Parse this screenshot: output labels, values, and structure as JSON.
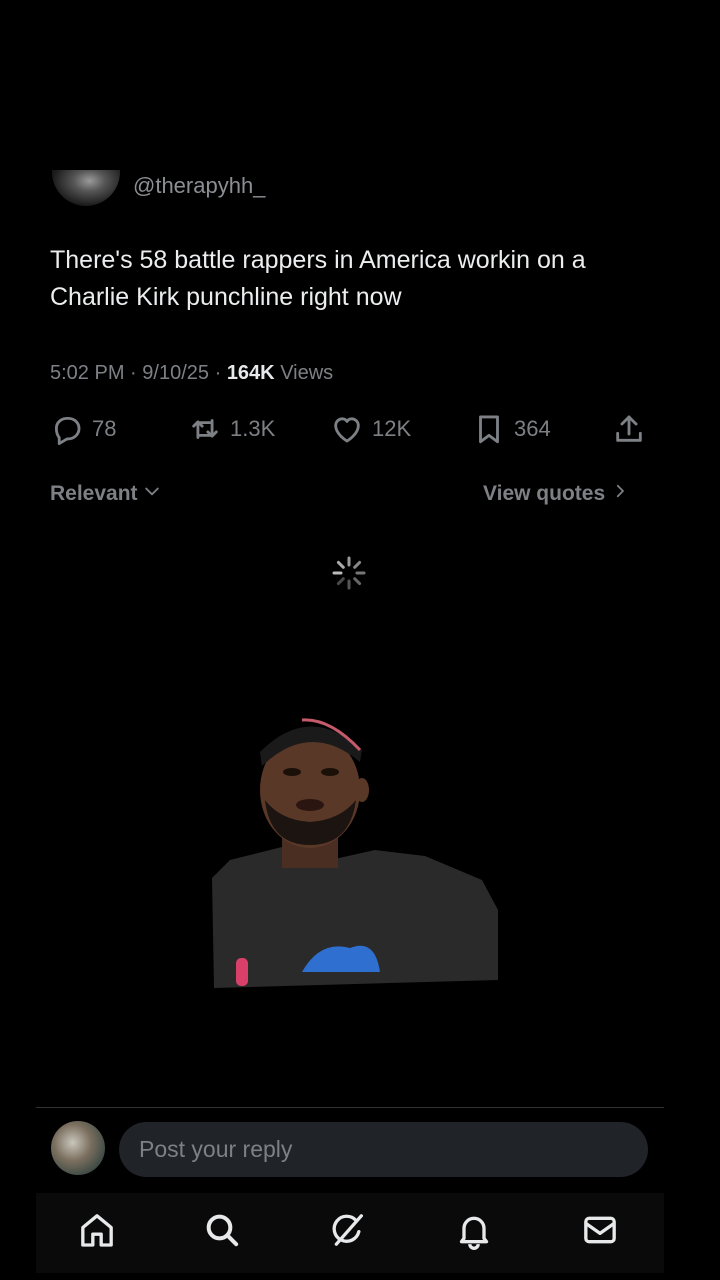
{
  "post": {
    "handle": "@therapyhh_",
    "text": "There's 58 battle rappers in America workin on a\nCharlie Kirk punchline right now",
    "time": "5:02 PM",
    "separator": "·",
    "date": "9/10/25",
    "views_count": "164K",
    "views_label": "Views"
  },
  "actions": {
    "replies": "78",
    "reposts": "1.3K",
    "likes": "12K",
    "bookmarks": "364"
  },
  "sort": {
    "relevant_label": "Relevant",
    "view_quotes_label": "View quotes"
  },
  "reply_bar": {
    "placeholder": "Post your reply"
  },
  "nav": {
    "items": [
      "home-icon",
      "search-icon",
      "grok-icon",
      "notifications-icon",
      "messages-icon"
    ]
  },
  "colors": {
    "background": "#000000",
    "text_primary": "#e7e9ea",
    "text_secondary": "#7d8185",
    "input_bg": "#202327"
  }
}
